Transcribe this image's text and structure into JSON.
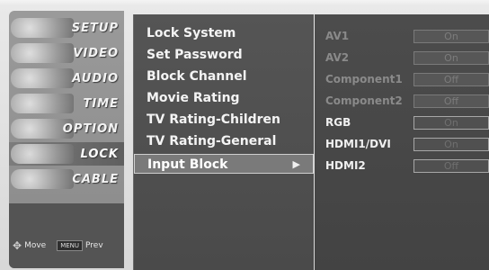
{
  "sidebar": {
    "categories": [
      {
        "label": "SETUP"
      },
      {
        "label": "VIDEO"
      },
      {
        "label": "AUDIO"
      },
      {
        "label": "TIME"
      },
      {
        "label": "OPTION",
        "badge": "Option"
      },
      {
        "label": "LOCK"
      },
      {
        "label": "CABLE"
      }
    ],
    "selected": "LOCK"
  },
  "footer": {
    "move_label": "Move",
    "prev_key": "MENU",
    "prev_label": "Prev"
  },
  "menu": {
    "items": [
      {
        "label": "Lock System"
      },
      {
        "label": "Set Password"
      },
      {
        "label": "Block Channel"
      },
      {
        "label": "Movie Rating"
      },
      {
        "label": "TV Rating-Children"
      },
      {
        "label": "TV Rating-General"
      },
      {
        "label": "Input Block",
        "arrow": "▶"
      }
    ],
    "active": "Input Block"
  },
  "input_block": {
    "rows": [
      {
        "name": "AV1",
        "value": "On"
      },
      {
        "name": "AV2",
        "value": "On"
      },
      {
        "name": "Component1",
        "value": "Off"
      },
      {
        "name": "Component2",
        "value": "Off"
      },
      {
        "name": "RGB",
        "value": "On"
      },
      {
        "name": "HDMI1/DVI",
        "value": "On"
      },
      {
        "name": "HDMI2",
        "value": "Off"
      }
    ]
  }
}
